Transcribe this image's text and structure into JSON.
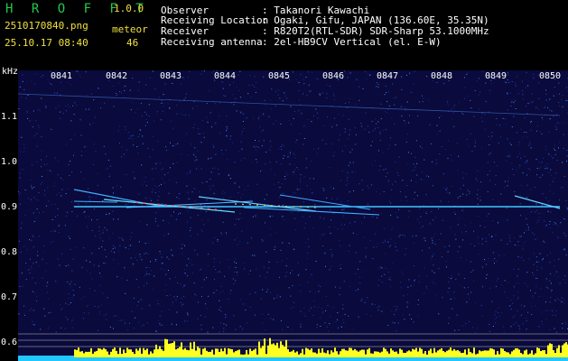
{
  "app": {
    "name": "H R O F F T",
    "version": "1.0.0"
  },
  "meta": {
    "file_name": "2510170840.png",
    "date_time": "25.10.17 08:40",
    "meteor_label": "meteor",
    "meteor_count": "46"
  },
  "info": [
    {
      "key": "Observer",
      "value": ": Takanori Kawachi"
    },
    {
      "key": "Receiving Location",
      "value": ": Ogaki, Gifu, JAPAN (136.60E, 35.35N)"
    },
    {
      "key": "Receiver",
      "value": ": R820T2(RTL-SDR) SDR-Sharp 53.1000MHz"
    },
    {
      "key": "Receiving antenna",
      "value": ": 2el-HB9CV Vertical (el. E-W)"
    }
  ],
  "axis": {
    "unit": "kHz",
    "time_ticks": [
      "0841",
      "0842",
      "0843",
      "0844",
      "0845",
      "0846",
      "0847",
      "0848",
      "0849",
      "0850"
    ],
    "freq_ticks": [
      "1.1",
      "1.0",
      "0.9",
      "0.8",
      "0.7",
      "0.6"
    ]
  },
  "colors": {
    "background": "#0a0a3c",
    "header_green": "#22c94a",
    "header_yellow": "#f0e040",
    "signal": "#40c8ff",
    "amplitude_bars": "#ffff20",
    "amplitude_base": "#20c8ff"
  }
}
